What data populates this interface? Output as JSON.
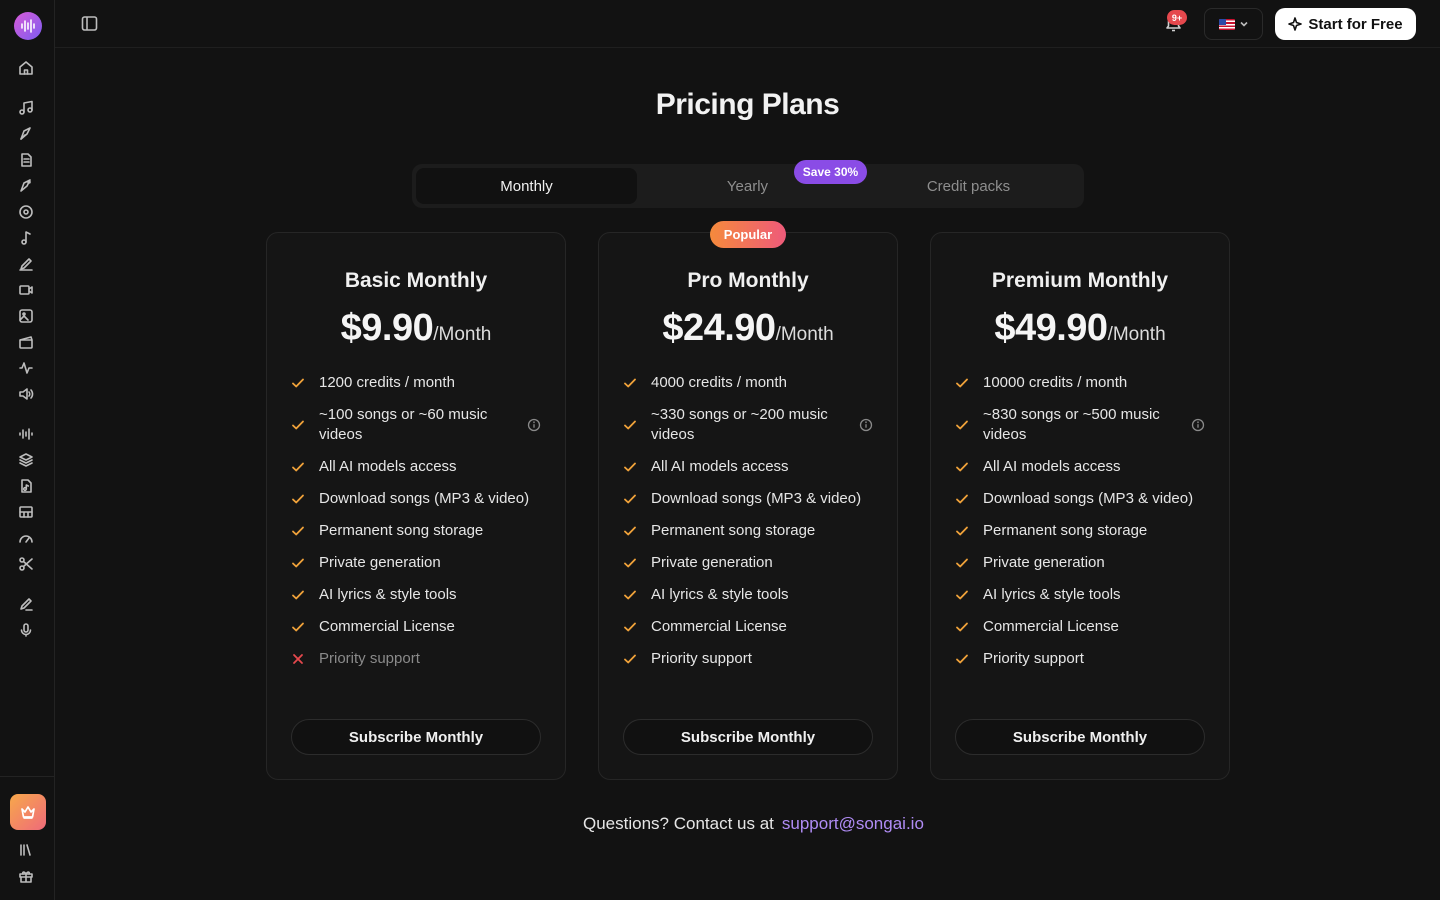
{
  "colors": {
    "background": "#121212",
    "accent_purple": "#8a4ce6",
    "check_orange": "#f0a23a",
    "cross_red": "#e5484d",
    "link_purple": "#b08cf5"
  },
  "sidebar": {
    "icons": [
      "home-icon",
      "music-note-icon",
      "pen-nib-icon",
      "document-icon",
      "brush-icon",
      "vinyl-icon",
      "single-note-icon",
      "pencil-icon",
      "video-camera-icon",
      "image-play-icon",
      "clapperboard-icon",
      "waveform-icon",
      "speaker-icon",
      "audio-bars-icon",
      "layers-icon",
      "audio-file-icon",
      "piano-icon",
      "gauge-icon",
      "scissors-icon",
      "edit-icon",
      "microphone-icon",
      "library-icon",
      "gift-icon"
    ]
  },
  "topbar": {
    "notification_badge": "9+",
    "language_flag": "us-flag-icon",
    "start_button": "Start for Free"
  },
  "page": {
    "title": "Pricing Plans",
    "tabs": [
      "Monthly",
      "Yearly",
      "Credit packs"
    ],
    "active_tab": "Monthly",
    "save_badge": "Save 30%",
    "popular_badge": "Popular"
  },
  "plans": [
    {
      "name": "Basic Monthly",
      "price": "$9.90",
      "period": "/Month",
      "features": [
        "1200 credits / month",
        "~100 songs or ~60 music videos",
        "All AI models access",
        "Download songs (MP3 & video)",
        "Permanent song storage",
        "Private generation",
        "AI lyrics & style tools",
        "Commercial License",
        "Priority support"
      ],
      "included": [
        true,
        true,
        true,
        true,
        true,
        true,
        true,
        true,
        false
      ],
      "button": "Subscribe Monthly"
    },
    {
      "name": "Pro Monthly",
      "price": "$24.90",
      "period": "/Month",
      "features": [
        "4000 credits / month",
        "~330 songs or ~200 music videos",
        "All AI models access",
        "Download songs (MP3 & video)",
        "Permanent song storage",
        "Private generation",
        "AI lyrics & style tools",
        "Commercial License",
        "Priority support"
      ],
      "included": [
        true,
        true,
        true,
        true,
        true,
        true,
        true,
        true,
        true
      ],
      "button": "Subscribe Monthly"
    },
    {
      "name": "Premium Monthly",
      "price": "$49.90",
      "period": "/Month",
      "features": [
        "10000 credits / month",
        "~830 songs or ~500 music videos",
        "All AI models access",
        "Download songs (MP3 & video)",
        "Permanent song storage",
        "Private generation",
        "AI lyrics & style tools",
        "Commercial License",
        "Priority support"
      ],
      "included": [
        true,
        true,
        true,
        true,
        true,
        true,
        true,
        true,
        true
      ],
      "button": "Subscribe Monthly"
    }
  ],
  "footer": {
    "contact_text": "Questions? Contact us at",
    "contact_email": "support@songai.io"
  }
}
